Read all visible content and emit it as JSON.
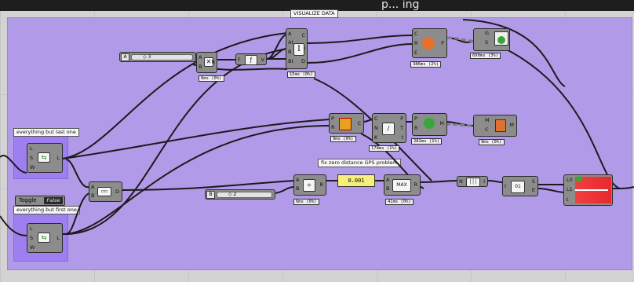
{
  "header_text": "p... ing",
  "group_title": "VISUALIZE DATA",
  "labels": {
    "everything_but_last": "everything but last one",
    "everything_but_first": "everything but first one",
    "fix_zero": "fix zero distance GPS problem"
  },
  "sliders": [
    {
      "tag": "A",
      "value": "◇ 3"
    },
    {
      "tag": "B",
      "value": "◇ 2"
    }
  ],
  "toggle": {
    "label": "Toggle",
    "value": "False"
  },
  "panel_value": "0.001",
  "timings": {
    "mult": "6ms (0%)",
    "text_tag": "15ms (0%)",
    "pipe": "386ms (2%)",
    "geo": "690ms (3%)",
    "circle": "9ms (0%)",
    "curve": "178ms (1%)",
    "sphere": "282ms (1%)",
    "mesh": "9ms (0%)",
    "divide": "6ms (0%)",
    "max": "41ms (0%)"
  },
  "ports": {
    "mult_in": [
      "A",
      "B"
    ],
    "mult_out": [
      "R"
    ],
    "text_in": [
      "A",
      "At",
      "B",
      "Bt"
    ],
    "text_out": [
      "C",
      "I",
      "D"
    ],
    "shift1_in": [
      "L",
      "S",
      "W"
    ],
    "shift1_out": [
      "L"
    ],
    "shift2_in": [
      "L",
      "S",
      "W"
    ],
    "shift2_out": [
      "L"
    ],
    "merge_in": [
      "A",
      "B"
    ],
    "merge_out": [
      "D"
    ],
    "div_in": [
      "A",
      "B"
    ],
    "div_out": [
      "R"
    ],
    "max_in": [
      "A",
      "B"
    ],
    "max_out": [
      "R"
    ],
    "pipe_in": [
      "C",
      "R",
      "E"
    ],
    "pipe_out": [
      "P"
    ],
    "geo_in": [
      "G",
      "S"
    ],
    "circle_in": [
      "P",
      "R"
    ],
    "circle_out": [
      "C"
    ],
    "curve_in": [
      "C",
      "N",
      "K"
    ],
    "curve_out": [
      "P",
      "T",
      "t"
    ],
    "sphere_in": [
      "P",
      "R"
    ],
    "sphere_out": [
      "M"
    ],
    "mesh_in": [
      "M",
      "C"
    ],
    "mesh_out": [
      "M"
    ],
    "seg_in": [
      "N"
    ],
    "seg_out": [
      "I"
    ],
    "idx_in": [
      "I"
    ],
    "idx_out": [
      "S",
      "E"
    ],
    "gradient_in": [
      "L0",
      "L1",
      "t"
    ]
  },
  "colors": {
    "group": "#b19ae8",
    "panel": "#f6f07a",
    "gradient": "#e8282e"
  }
}
